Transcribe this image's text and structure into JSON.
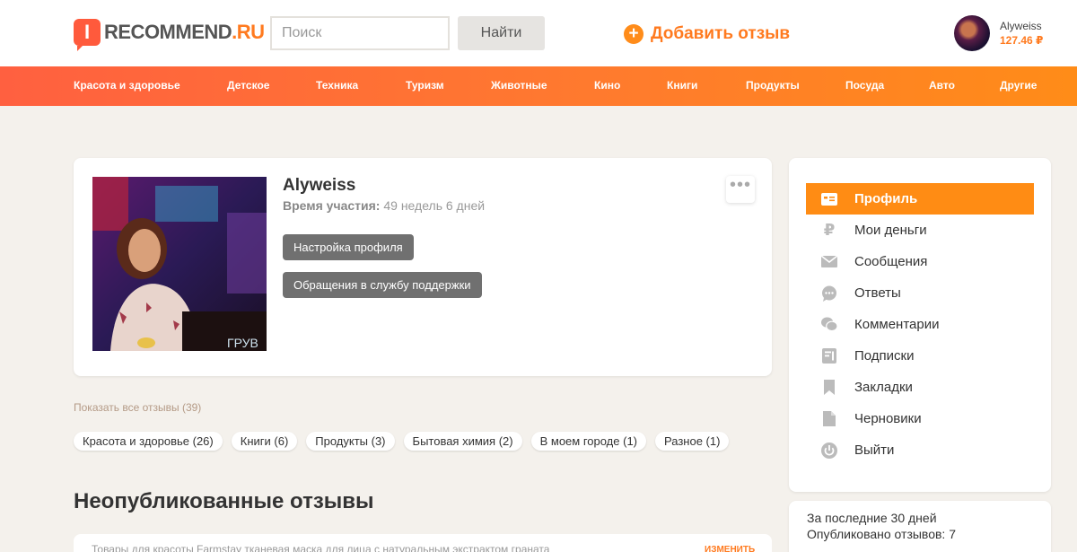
{
  "header": {
    "logo_letter": "I",
    "logo_main": "RECOMMEND",
    "logo_ru": ".RU",
    "search_placeholder": "Поиск",
    "search_button": "Найти",
    "add_review": "Добавить отзыв",
    "user_name": "Alyweiss",
    "user_money": "127.46 ₽"
  },
  "nav": {
    "items": [
      "Красота и здоровье",
      "Детское",
      "Техника",
      "Туризм",
      "Животные",
      "Кино",
      "Книги",
      "Продукты",
      "Посуда",
      "Авто",
      "Другие"
    ]
  },
  "profile": {
    "name": "Alyweiss",
    "participation_label": "Время участия:",
    "participation_value": "49 недель 6 дней",
    "settings_button": "Настройка профиля",
    "support_button": "Обращения в службу поддержки",
    "more_icon": "more-dots-icon",
    "photo_caption": "ГРУВ"
  },
  "reviews": {
    "show_all": "Показать все отзывы (39)",
    "tags": [
      "Красота и здоровье (26)",
      "Книги (6)",
      "Продукты (3)",
      "Бытовая химия (2)",
      "В моем городе (1)",
      "Разное (1)"
    ],
    "unpublished_title": "Неопубликованные отзывы",
    "first_item_text": "Товары для красоты Farmstay тканевая маска для лица с натуральным экстрактом граната",
    "first_item_action": "ИЗМЕНИТЬ"
  },
  "sidebar": {
    "items": [
      {
        "label": "Профиль",
        "icon": "profile-card-icon",
        "active": true
      },
      {
        "label": "Мои деньги",
        "icon": "ruble-icon",
        "active": false
      },
      {
        "label": "Сообщения",
        "icon": "envelope-icon",
        "active": false
      },
      {
        "label": "Ответы",
        "icon": "chat-bubble-icon",
        "active": false
      },
      {
        "label": "Комментарии",
        "icon": "comments-icon",
        "active": false
      },
      {
        "label": "Подписки",
        "icon": "subscriptions-icon",
        "active": false
      },
      {
        "label": "Закладки",
        "icon": "bookmark-icon",
        "active": false
      },
      {
        "label": "Черновики",
        "icon": "draft-icon",
        "active": false
      },
      {
        "label": "Выйти",
        "icon": "power-icon",
        "active": false
      }
    ]
  },
  "stats": {
    "period": "За последние 30 дней",
    "published": "Опубликовано отзывов: 7"
  },
  "colors": {
    "accent": "#ff7a1f",
    "nav_start": "#ff6040",
    "nav_end": "#ff8c18",
    "page_bg": "#f4f1ec"
  }
}
